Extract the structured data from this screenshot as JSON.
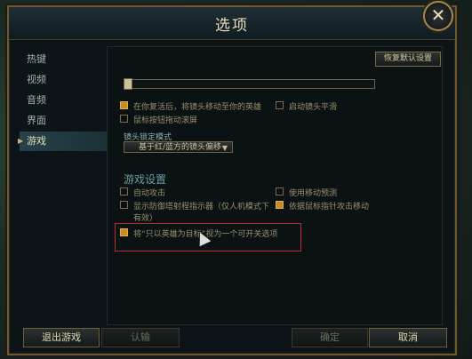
{
  "window": {
    "title": "选项"
  },
  "icons": {
    "close": "close-icon",
    "active_arrow": "arrow-right-icon",
    "dropdown": "chevron-down-icon"
  },
  "sidebar": {
    "items": [
      {
        "label": "热键",
        "active": false
      },
      {
        "label": "视频",
        "active": false
      },
      {
        "label": "音频",
        "active": false
      },
      {
        "label": "界面",
        "active": false
      },
      {
        "label": "游戏",
        "active": true
      }
    ]
  },
  "panel": {
    "restore_button": "恢复默认设置",
    "slider_value": 0,
    "options_top": [
      {
        "label": "在你复活后，将镜头移动至你的英雄",
        "checked": true
      },
      {
        "label": "启动镜头平滑",
        "checked": false
      },
      {
        "label": "鼠标按钮拖动滚屏",
        "checked": false
      }
    ],
    "camera_lock": {
      "label": "镜头锁定模式",
      "selected": "基于红/蓝方的镜头偏移"
    },
    "game_settings": {
      "title": "游戏设置",
      "options": [
        {
          "label": "自动攻击",
          "checked": false
        },
        {
          "label": "使用移动预测",
          "checked": false
        },
        {
          "label": "显示防御塔射程指示器（仅人机模式下有效）",
          "checked": false
        },
        {
          "label": "依据鼠标指针攻击移动",
          "checked": true
        },
        {
          "label": "将“只以英雄为目标”视为一个可开关选项",
          "checked": true
        }
      ]
    }
  },
  "footer": {
    "exit": "退出游戏",
    "surrender": "认输",
    "confirm": "确定",
    "cancel": "取消"
  },
  "colors": {
    "accent": "#c88a24",
    "border_gold": "#6d5a35",
    "highlight_red": "#c12a2a"
  }
}
